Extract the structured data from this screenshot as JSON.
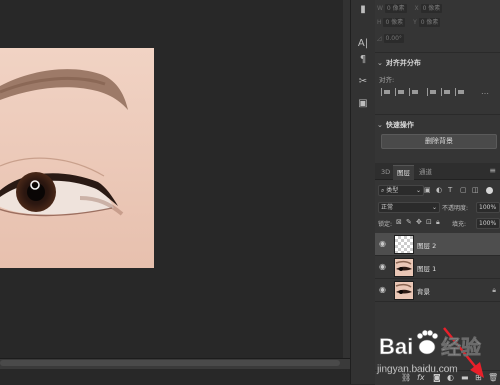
{
  "properties": {
    "dim_w": "0 像素",
    "dim_h": "0 像素",
    "dim_x": "0 像素",
    "dim_y": "0 像素",
    "angle": "0.00°"
  },
  "align": {
    "title": "对齐并分布",
    "sub": "对齐:"
  },
  "quick": {
    "title": "快速操作",
    "remove_bg": "删除背景"
  },
  "layers": {
    "tabs": [
      "3D",
      "图层",
      "通道"
    ],
    "filter_kind": "类型",
    "blend_mode": "正常",
    "opacity_label": "不透明度:",
    "opacity_value": "100%",
    "lock_label": "锁定:",
    "fill_label": "填充:",
    "fill_value": "100%",
    "items": [
      {
        "name": "图层 2"
      },
      {
        "name": "图层 1"
      },
      {
        "name": "背景"
      }
    ]
  },
  "watermark": {
    "brand": "Bai",
    "brand2": "经验",
    "url": "jingyan.baidu.com"
  },
  "icons": {
    "eye": "eye-icon",
    "lock": "lock-icon",
    "link": "link-icon",
    "fx": "fx-icon",
    "mask": "mask-icon",
    "adjust": "adjustment-icon",
    "folder": "folder-icon",
    "new": "new-layer-icon",
    "trash": "trash-icon"
  },
  "colors": {
    "panel": "#353535",
    "canvas_bg": "#282828",
    "selected_layer": "#4e4e4e",
    "arrow": "#e8202a"
  }
}
